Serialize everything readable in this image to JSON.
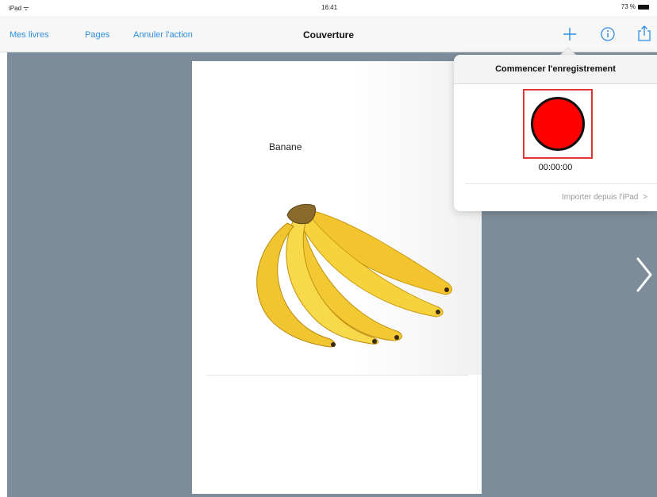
{
  "status_bar": {
    "device": "iPad ᯤ",
    "time": "16:41",
    "battery": "73 %"
  },
  "nav": {
    "my_books": "Mes livres",
    "pages": "Pages",
    "undo": "Annuler l'action",
    "title": "Couverture",
    "add_icon": "plus-icon",
    "info_icon": "info-icon",
    "share_icon": "share-icon"
  },
  "page": {
    "word": "Banane",
    "image": "banana-bunch"
  },
  "popover": {
    "title": "Commencer l'enregistrement",
    "timer": "00:00:00",
    "import_link": "Importer depuis l'iPad",
    "import_chevron": ">"
  },
  "colors": {
    "accent": "#2e8de0",
    "editor_background": "#7d8c9a",
    "record": "#ff0000",
    "record_highlight": "#e03535"
  }
}
